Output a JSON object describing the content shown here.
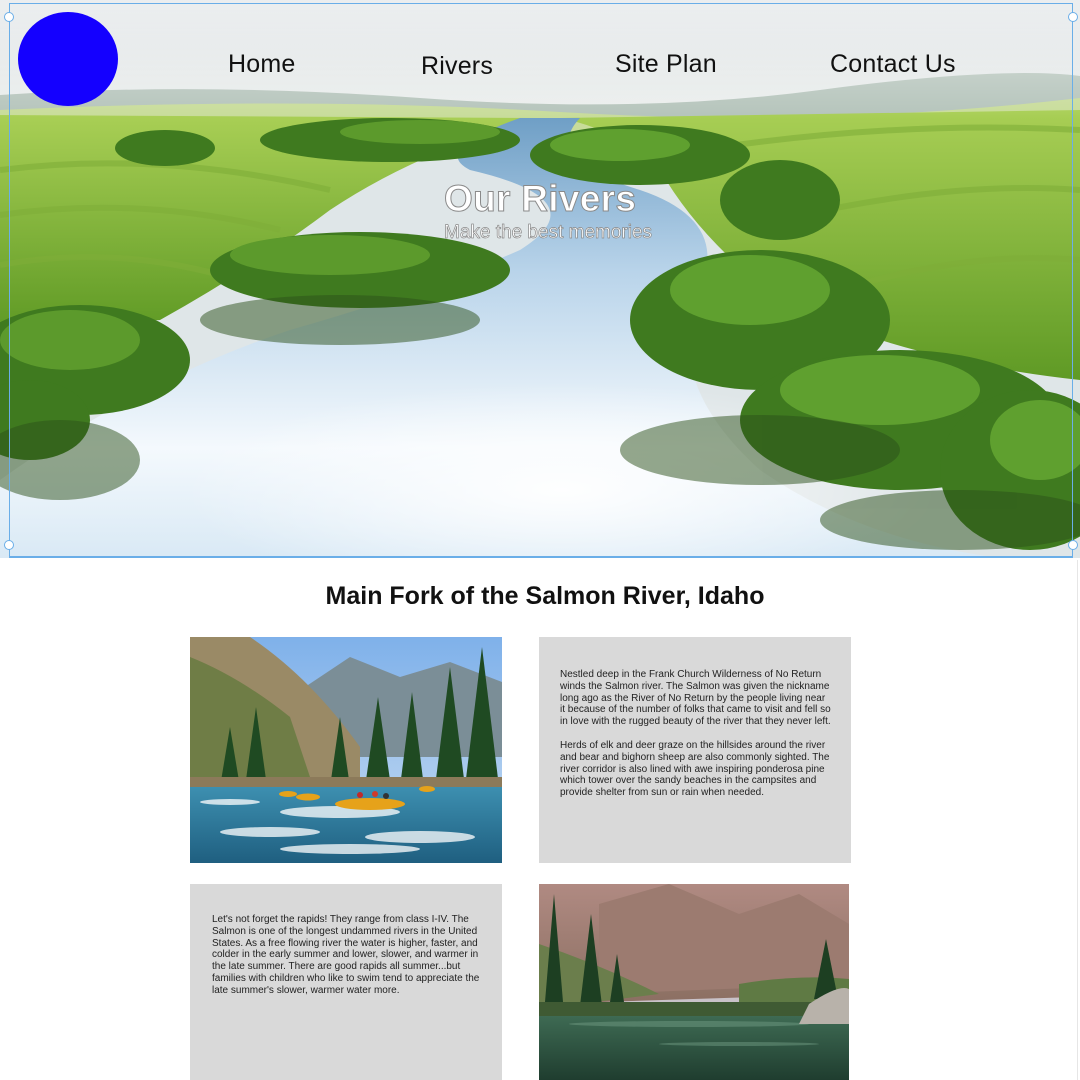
{
  "nav": {
    "home": "Home",
    "rivers": "Rivers",
    "site_plan": "Site Plan",
    "contact": "Contact Us"
  },
  "hero": {
    "title": "Our Rivers",
    "subtitle": "Make the best memories"
  },
  "section": {
    "title": "Main Fork of the Salmon River, Idaho"
  },
  "cards": {
    "intro": {
      "paragraph1": "Nestled deep in the Frank Church Wilderness of No Return winds the Salmon river. The Salmon was given the nickname long ago as the River of No Return by the people living near it because of the number of folks that came to visit and fell so in love with the rugged beauty of the river that they never left.",
      "paragraph2": "Herds of elk and deer graze on the hillsides around the river and bear and bighorn sheep are also commonly sighted. The river corridor is also lined with awe inspiring ponderosa pine which tower over the sandy beaches in the campsites and provide shelter from sun or rain when needed."
    },
    "rapids": {
      "paragraph1": "Let's not forget the rapids! They range from class I-IV. The Salmon is one of the longest undammed rivers in the United States. As a free flowing river the water is higher, faster, and colder in the early summer and lower, slower, and warmer in the late summer. There are good rapids all summer...but families with children who like to swim tend to appreciate the late summer's slower, warmer water more."
    }
  },
  "colors": {
    "logo": "#1400ff",
    "text_card_bg": "#d9d9d9",
    "selection_outline": "#6aaee8"
  }
}
